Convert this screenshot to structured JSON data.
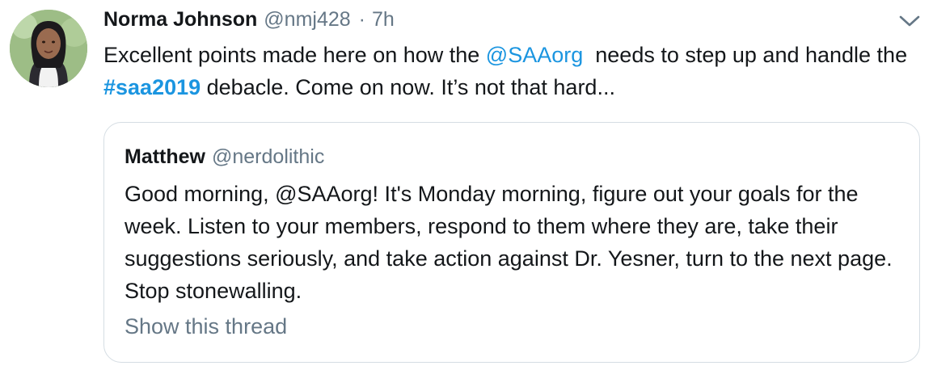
{
  "tweet": {
    "author_name": "Norma Johnson",
    "author_handle": "@nmj428",
    "separator": "·",
    "time": "7h",
    "text": {
      "part1": "Excellent points made here on how the ",
      "mention": "@SAAorg",
      "part2": "  needs to step up and handle the ",
      "hashtag": "#saa2019",
      "part3": " debacle. Come on now. It’s not that hard..."
    },
    "menu_icon": "chevron-down-icon"
  },
  "quoted": {
    "author_name": "Matthew",
    "author_handle": "@nerdolithic",
    "text": "Good morning, @SAAorg! It's Monday morning, figure out your goals for the week. Listen to your members, respond to them where they are, take their suggestions seriously, and take action against Dr. Yesner, turn to the next page. Stop stonewalling.",
    "show_thread": "Show this thread"
  },
  "colors": {
    "link": "#1b95e0",
    "secondary_text": "#657786",
    "border": "#d5dde3"
  }
}
